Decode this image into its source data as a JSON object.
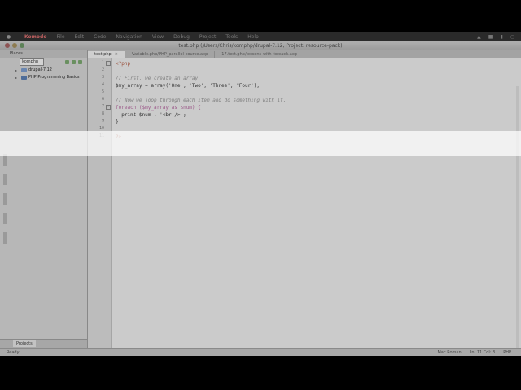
{
  "menubar": {
    "app_name": "Komodo",
    "items": [
      "File",
      "Edit",
      "Code",
      "Navigation",
      "View",
      "Debug",
      "Project",
      "Tools",
      "Help"
    ]
  },
  "window": {
    "title": "test.php (/Users/Chris/komphp/drupal-7.12, Project: resource-pack)"
  },
  "sidebar": {
    "header": "Places",
    "selector": "komphp",
    "tree": [
      {
        "label": "drupal-7.12"
      },
      {
        "label": "PHP Programming Basics"
      }
    ],
    "bottom_tab": "Projects"
  },
  "tabs": [
    {
      "label": "test.php",
      "active": true
    },
    {
      "label": "Variable.php/PHP_parallel-course.aep",
      "active": false
    },
    {
      "label": "17.test.php/lessons-with-foreach.aep",
      "active": false
    }
  ],
  "editor": {
    "line_numbers": [
      "1",
      "2",
      "3",
      "4",
      "5",
      "6",
      "7",
      "8",
      "9",
      "10",
      "11"
    ],
    "lines": [
      "<?php",
      "",
      "// First, we create an array",
      "$my_array = array('One', 'Two', 'Three', 'Four');",
      "",
      "// Now we loop through each item and do something with it.",
      "foreach ($my_array as $num) {",
      "  print $num . '<br />';",
      "}",
      "",
      "?>"
    ]
  },
  "statusbar": {
    "left": "Ready",
    "encoding": "Mac Roman",
    "position": "Ln: 11 Col: 3",
    "language": "PHP"
  },
  "colors": {
    "highlight": "#ffffff",
    "keyword": "#9c5a8a",
    "string": "#5a6f93",
    "comment": "#7e7e7e"
  }
}
